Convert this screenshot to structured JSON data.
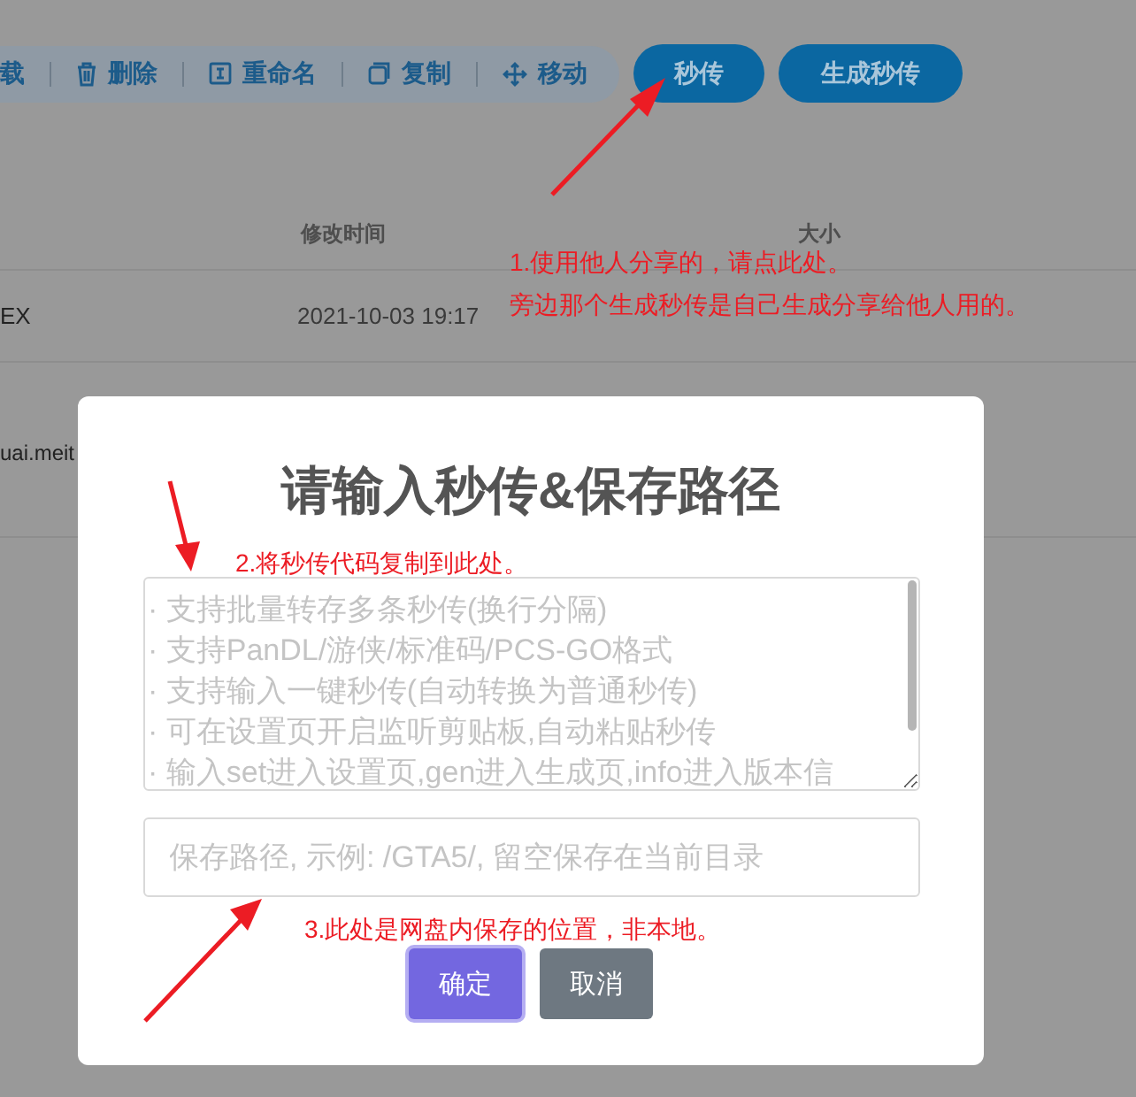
{
  "toolbar": {
    "actions": [
      {
        "label": "载"
      },
      {
        "label": "删除",
        "kind": "delete"
      },
      {
        "label": "重命名",
        "kind": "rename"
      },
      {
        "label": "复制",
        "kind": "copy"
      },
      {
        "label": "移动",
        "kind": "move"
      }
    ],
    "buttons": [
      {
        "label": "秒传"
      },
      {
        "label": "生成秒传"
      }
    ]
  },
  "table": {
    "columns": [
      {
        "label": "修改时间"
      },
      {
        "label": "大小"
      }
    ],
    "rows": [
      {
        "name": "EX",
        "modified": "2021-10-03 19:17"
      },
      {
        "name": "uai.meit"
      }
    ]
  },
  "dialog": {
    "title": "请输入秒传&保存路径",
    "code_field": {
      "placeholder": "· 支持批量转存多条秒传(换行分隔)\n· 支持PanDL/游侠/标准码/PCS-GO格式\n· 支持输入一键秒传(自动转换为普通秒传)\n· 可在设置页开启监听剪贴板,自动粘贴秒传\n· 输入set进入设置页,gen进入生成页,info进入版本信"
    },
    "path_field": {
      "placeholder": "保存路径, 示例: /GTA5/, 留空保存在当前目录"
    },
    "buttons": [
      {
        "label": "确定",
        "kind": "primary"
      },
      {
        "label": "取消",
        "kind": "secondary"
      }
    ]
  },
  "annotations": [
    {
      "lines": [
        "1.使用他人分享的，请点此处。",
        "旁边那个生成秒传是自己生成分享给他人用的。"
      ]
    },
    {
      "lines": [
        "2.将秒传代码复制到此处。"
      ]
    },
    {
      "lines": [
        "3.此处是网盘内保存的位置，非本地。"
      ]
    }
  ]
}
